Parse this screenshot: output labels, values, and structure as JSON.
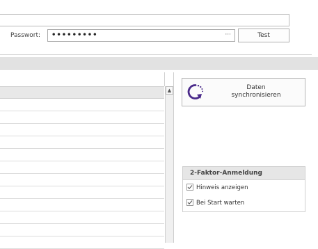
{
  "connection": {
    "password_label": "Passwort:",
    "password_value": "•••••••••",
    "password_browse": "···",
    "test_button": "Test"
  },
  "sync": {
    "label_line1": "Daten",
    "label_line2": "synchronisieren",
    "icon": "sync-icon",
    "accent": "#4a2a8a"
  },
  "two_factor": {
    "title": "2-Faktor-Anmeldung",
    "options": [
      {
        "label": "Hinweis anzeigen",
        "checked": true
      },
      {
        "label": "Bei Start warten",
        "checked": true
      }
    ]
  },
  "grid": {
    "scroll_up": "▲"
  }
}
